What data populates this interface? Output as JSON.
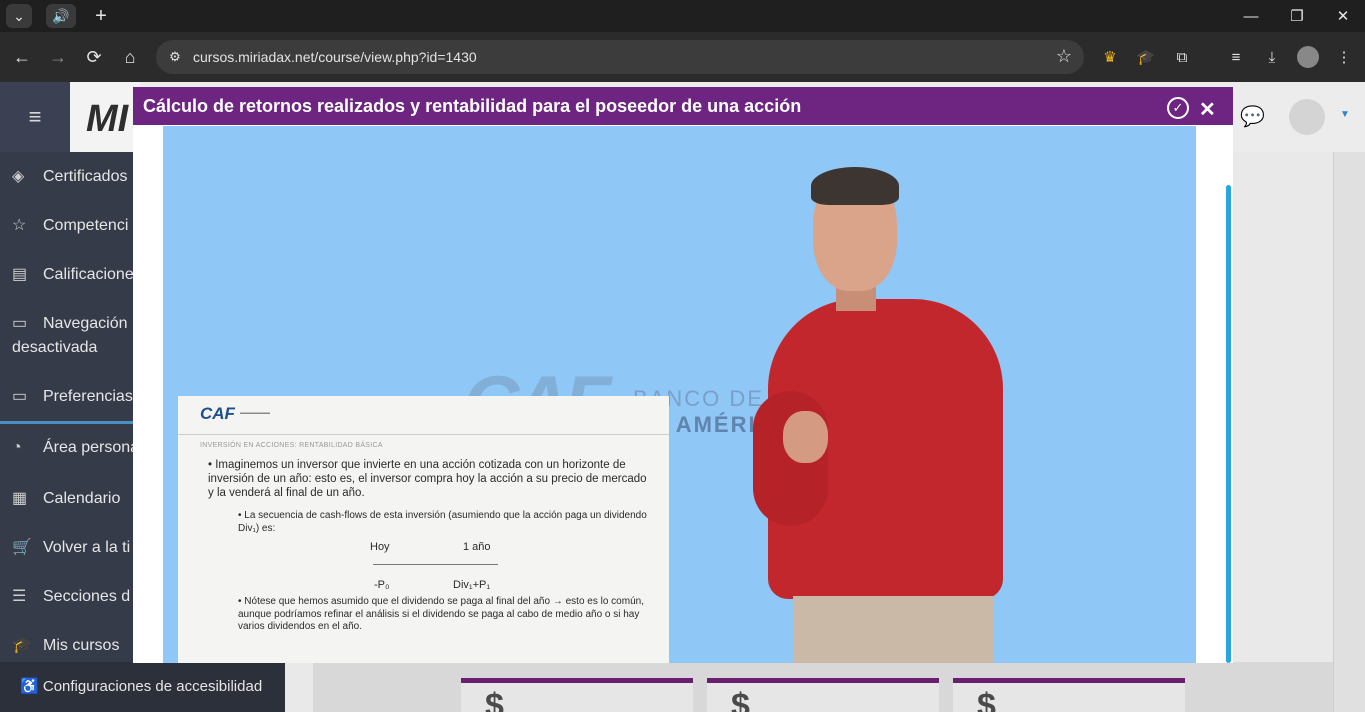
{
  "browser": {
    "url": "cursos.miriadax.net/course/view.php?id=1430",
    "new_tab_glyph": "+",
    "nav": {
      "back": "←",
      "forward": "→",
      "reload": "⟳",
      "home": "⌂"
    },
    "window": {
      "minimize": "—",
      "restore": "❐",
      "close": "✕"
    }
  },
  "site": {
    "logo_text": "MI"
  },
  "sidebar": {
    "items": [
      {
        "label": "Certificados",
        "icon": "layers-icon"
      },
      {
        "label": "Competenci",
        "icon": "star-icon"
      },
      {
        "label": "Calificacione",
        "icon": "book-icon"
      },
      {
        "label": "Navegación",
        "label2": "desactivada",
        "icon": "folder-icon"
      },
      {
        "label": "Preferencias",
        "icon": "folder-icon"
      },
      {
        "label": "Área persona",
        "icon": "dashboard-icon"
      },
      {
        "label": "Calendario",
        "icon": "calendar-icon"
      },
      {
        "label": "Volver a la ti",
        "icon": "cart-icon"
      },
      {
        "label": "Secciones d",
        "icon": "list-icon"
      },
      {
        "label": "Mis cursos",
        "icon": "graduation-icon"
      }
    ],
    "footer": "Configuraciones de accesibilidad"
  },
  "cards": {
    "symbol": "$"
  },
  "modal": {
    "title": "Cálculo de retornos realizados y rentabilidad para el poseedor de una acción",
    "header_color": "#6e2582"
  },
  "video": {
    "watermark": {
      "logo": "CAF",
      "line1": "BANCO DE DE",
      "line2_prefix": "DE ",
      "line2_bold": "AMÉRICA"
    },
    "slide": {
      "logo": "CAF",
      "heading": "INVERSIÓN EN ACCIONES: RENTABILIDAD BÁSICA",
      "bullet1": "• Imaginemos un inversor que invierte en una acción cotizada con un horizonte de inversión de un año: esto es, el inversor compra hoy la acción a su precio de mercado y la venderá al final de un año.",
      "bullet2": "• La secuencia de cash-flows de esta inversión (asumiendo que la acción paga un dividendo Div₁) es:",
      "hoy": "Hoy",
      "ano": "1 año",
      "p0": "-P₀",
      "div": "Div₁+P₁",
      "bullet3": "• Nótese que hemos asumido que el dividendo se paga al final del año → esto es lo común, aunque podríamos refinar el análisis si el dividendo se paga al cabo de medio año o si hay varios dividendos en el año."
    }
  }
}
